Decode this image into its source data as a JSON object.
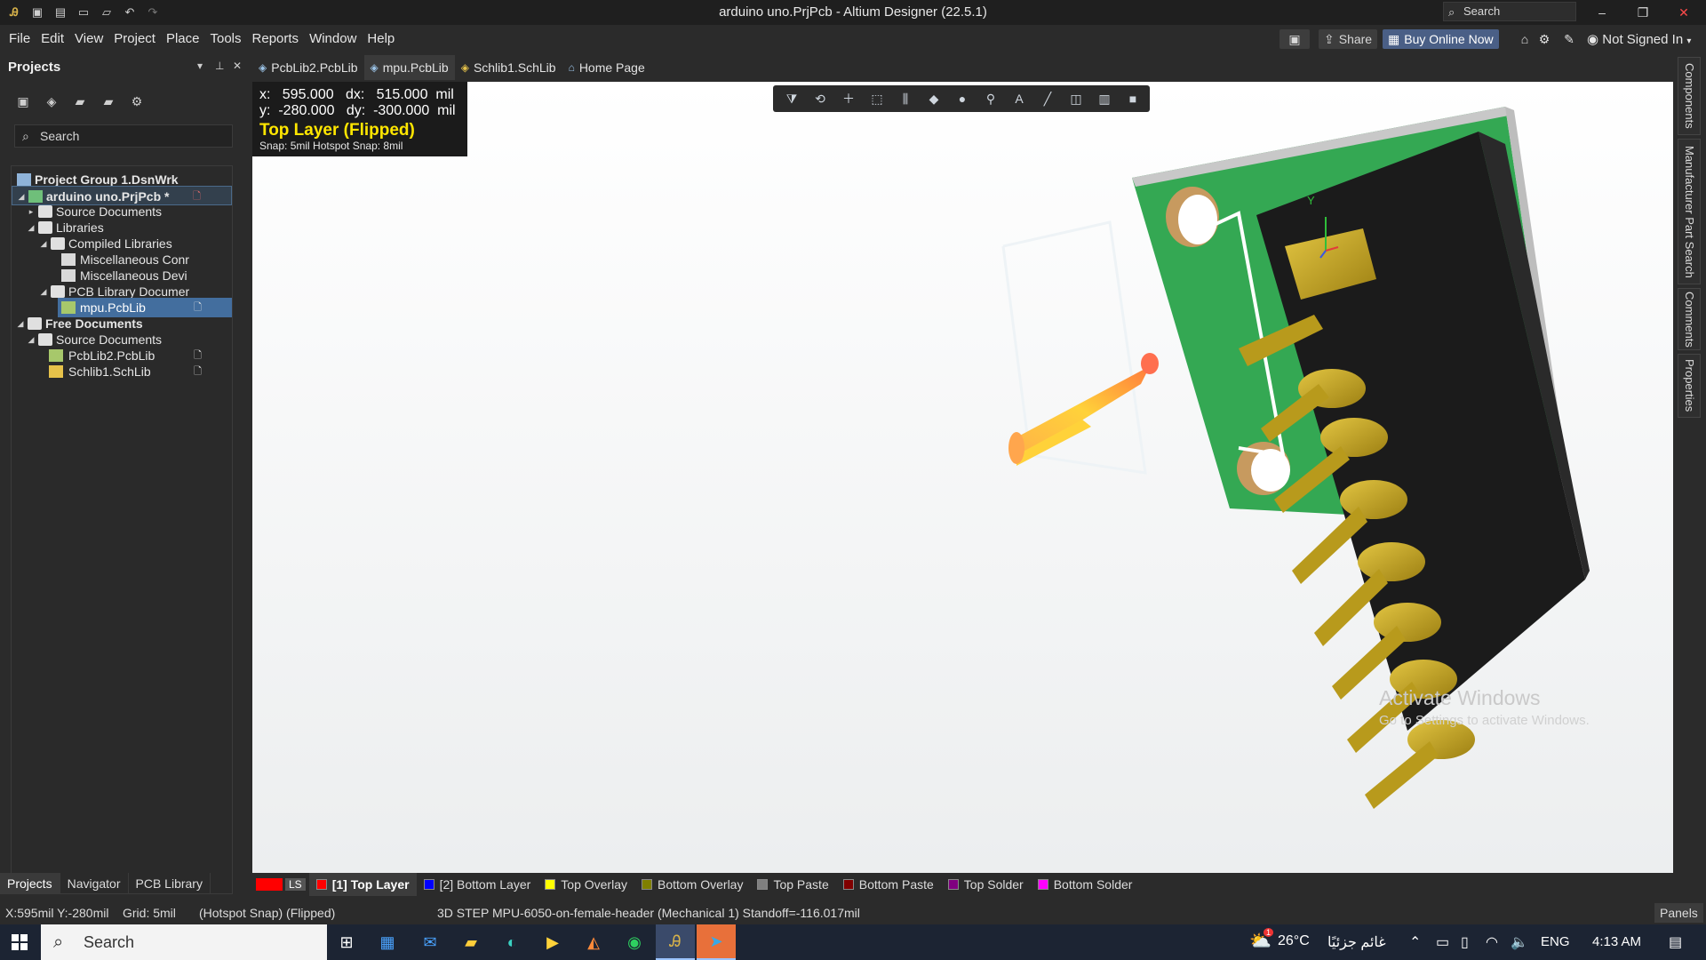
{
  "window": {
    "title": "arduino uno.PrjPcb - Altium Designer (22.5.1)",
    "search_placeholder": "Search",
    "controls": {
      "minimize": "–",
      "restore": "❐",
      "close": "✕"
    }
  },
  "quick_access": [
    "save-icon",
    "save-all-icon",
    "open-icon",
    "open-project-icon",
    "undo-icon",
    "redo-icon"
  ],
  "menu": [
    "File",
    "Edit",
    "View",
    "Project",
    "Place",
    "Tools",
    "Reports",
    "Window",
    "Help"
  ],
  "menu_right": {
    "share": "Share",
    "buy": "Buy Online Now",
    "user": "Not Signed In"
  },
  "projects_panel": {
    "title": "Projects",
    "search_placeholder": "Search",
    "tree": [
      {
        "label": "Project Group 1.DsnWrk",
        "bold": true
      },
      {
        "label": "arduino uno.PrjPcb *",
        "bold": true
      },
      {
        "label": "Source Documents"
      },
      {
        "label": "Libraries"
      },
      {
        "label": "Compiled Libraries"
      },
      {
        "label": "Miscellaneous Conr"
      },
      {
        "label": "Miscellaneous Devi"
      },
      {
        "label": "PCB Library Documer"
      },
      {
        "label": "mpu.PcbLib"
      },
      {
        "label": "Free Documents",
        "bold": true
      },
      {
        "label": "Source Documents"
      },
      {
        "label": "PcbLib2.PcbLib"
      },
      {
        "label": "Schlib1.SchLib"
      }
    ],
    "bottom_tabs": [
      "Projects",
      "Navigator",
      "PCB Library"
    ]
  },
  "document_tabs": [
    {
      "label": "PcbLib2.PcbLib",
      "active": false
    },
    {
      "label": "mpu.PcbLib",
      "active": true
    },
    {
      "label": "Schlib1.SchLib",
      "active": false
    },
    {
      "label": "Home Page",
      "active": false
    }
  ],
  "hud": {
    "line1": "x:   595.000   dx:   515.000  mil",
    "line2": "y:  -280.000   dy:  -300.000  mil",
    "layer": "Top Layer (Flipped)",
    "snap": "Snap: 5mil Hotspot Snap: 8mil"
  },
  "view_toolbar": [
    "filter-icon",
    "route-icon",
    "add-icon",
    "select-rect-icon",
    "chart-icon",
    "pad-icon",
    "via-icon",
    "place-icon",
    "text-icon",
    "line-icon",
    "dimension-icon",
    "graph-icon",
    "region-icon"
  ],
  "axis_label": "Y",
  "watermark": {
    "title": "Activate Windows",
    "subtitle": "Go to Settings to activate Windows."
  },
  "side_panels": [
    "Components",
    "Manufacturer Part Search",
    "Comments",
    "Properties"
  ],
  "layer_tabs": [
    {
      "label": "[1] Top Layer",
      "color": "#ff0000",
      "active": true
    },
    {
      "label": "[2] Bottom Layer",
      "color": "#0000ff",
      "active": false
    },
    {
      "label": "Top Overlay",
      "color": "#ffff00",
      "active": false
    },
    {
      "label": "Bottom Overlay",
      "color": "#808000",
      "active": false
    },
    {
      "label": "Top Paste",
      "color": "#808080",
      "active": false
    },
    {
      "label": "Bottom Paste",
      "color": "#800000",
      "active": false
    },
    {
      "label": "Top Solder",
      "color": "#800080",
      "active": false
    },
    {
      "label": "Bottom Solder",
      "color": "#ff00ff",
      "active": false
    }
  ],
  "ls_label": "LS",
  "status": {
    "coords": "X:595mil Y:-280mil",
    "grid": "Grid: 5mil",
    "snap": "(Hotspot Snap) (Flipped)",
    "object": "3D STEP MPU-6050-on-female-header (Mechanical 1)  Standoff=-116.017mil",
    "panels": "Panels"
  },
  "taskbar": {
    "search": "Search",
    "weather": "26°C",
    "weather_text": "غائم جزئيًا",
    "weather_badge": "1",
    "lang": "ENG",
    "time": "4:13 AM"
  }
}
